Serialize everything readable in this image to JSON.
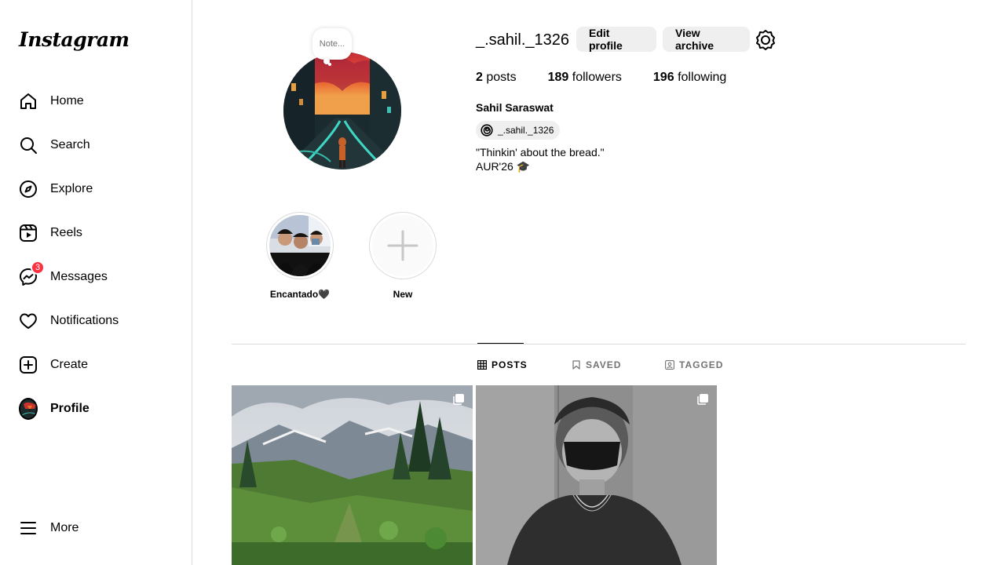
{
  "app": {
    "logo_text": "Instagram"
  },
  "sidebar": {
    "items": [
      {
        "label": "Home",
        "icon": "home-icon"
      },
      {
        "label": "Search",
        "icon": "search-icon"
      },
      {
        "label": "Explore",
        "icon": "compass-icon"
      },
      {
        "label": "Reels",
        "icon": "reels-icon"
      },
      {
        "label": "Messages",
        "icon": "messenger-icon",
        "badge": "3"
      },
      {
        "label": "Notifications",
        "icon": "heart-icon"
      },
      {
        "label": "Create",
        "icon": "plus-square-icon"
      },
      {
        "label": "Profile",
        "icon": "avatar"
      }
    ],
    "more_label": "More"
  },
  "profile": {
    "note_placeholder": "Note...",
    "username": "_.sahil._1326",
    "edit_button": "Edit profile",
    "archive_button": "View archive",
    "stats": {
      "posts_count": "2",
      "posts_label": "posts",
      "followers_count": "189",
      "followers_label": "followers",
      "following_count": "196",
      "following_label": "following"
    },
    "full_name": "Sahil Saraswat",
    "threads_handle": "_.sahil._1326",
    "bio_line1": "\"Thinkin' about the bread.\"",
    "bio_line2": "AUR'26 🎓"
  },
  "highlights": [
    {
      "label": "Encantado🖤"
    },
    {
      "label": "New"
    }
  ],
  "tabs": [
    {
      "label": "POSTS",
      "active": true
    },
    {
      "label": "SAVED",
      "active": false
    },
    {
      "label": "TAGGED",
      "active": false
    }
  ],
  "colors": {
    "badge": "#ff3040",
    "divider": "#dbdbdb",
    "button_bg": "#efefef"
  }
}
